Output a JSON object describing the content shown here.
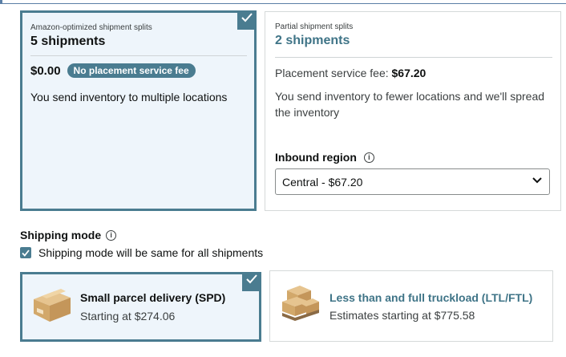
{
  "split_options": {
    "amazon_optimized": {
      "subtitle": "Amazon-optimized shipment splits",
      "count_label": "5 shipments",
      "price": "$0.00",
      "fee_badge": "No placement service fee",
      "description": "You send inventory to multiple locations",
      "selected": true
    },
    "partial": {
      "subtitle": "Partial shipment splits",
      "count_label": "2 shipments",
      "fee_prefix": "Placement service fee: ",
      "fee_value": "$67.20",
      "description": "You send inventory to fewer locations and we'll spread the inventory",
      "inbound_region_label": "Inbound region",
      "inbound_region_value": "Central - $67.20",
      "selected": false
    }
  },
  "shipping_mode": {
    "label": "Shipping mode",
    "same_for_all_label": "Shipping mode will be same for all shipments",
    "same_for_all_checked": true,
    "options": [
      {
        "title": "Small parcel delivery (SPD)",
        "subtitle": "Starting at $274.06",
        "selected": true,
        "icon": "box-icon"
      },
      {
        "title": "Less than and full truckload (LTL/FTL)",
        "subtitle": "Estimates starting at $775.58",
        "selected": false,
        "icon": "pallet-icon"
      }
    ]
  },
  "colors": {
    "accent": "#4a7c90",
    "selected_bg": "#eef5fb",
    "link_teal": "#3f7487"
  }
}
